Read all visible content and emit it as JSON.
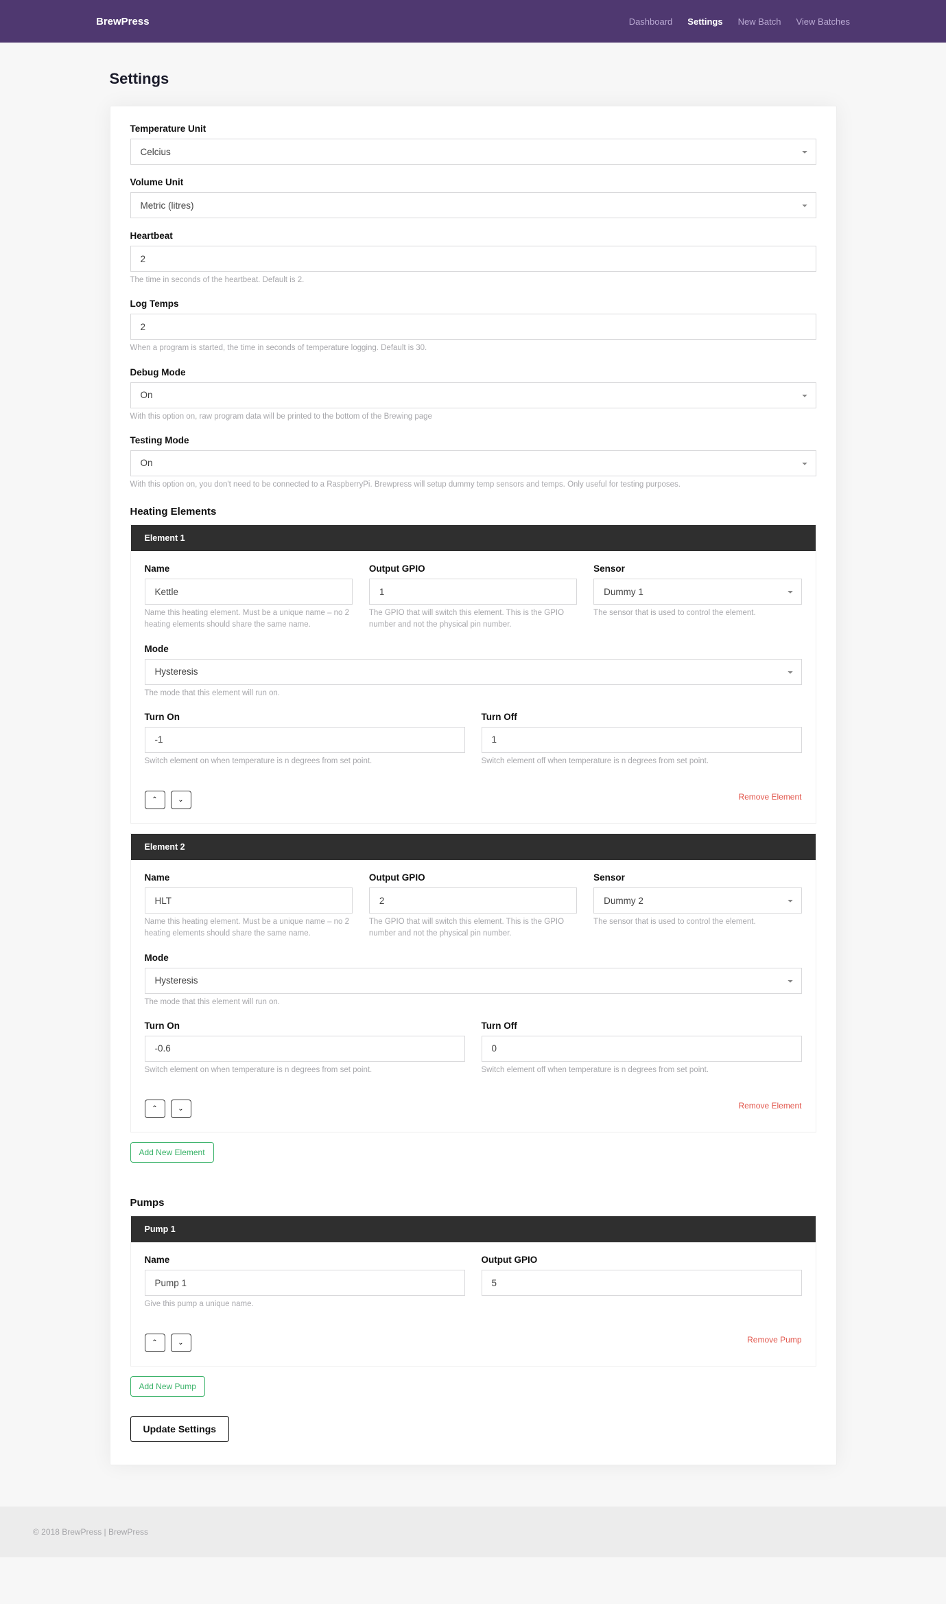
{
  "brand": "BrewPress",
  "nav": {
    "dashboard": "Dashboard",
    "settings": "Settings",
    "newBatch": "New Batch",
    "viewBatches": "View Batches"
  },
  "pageTitle": "Settings",
  "tempUnit": {
    "label": "Temperature Unit",
    "value": "Celcius"
  },
  "volUnit": {
    "label": "Volume Unit",
    "value": "Metric (litres)"
  },
  "heartbeat": {
    "label": "Heartbeat",
    "value": "2",
    "help": "The time in seconds of the heartbeat. Default is 2."
  },
  "logTemps": {
    "label": "Log Temps",
    "value": "2",
    "help": "When a program is started, the time in seconds of temperature logging. Default is 30."
  },
  "debugMode": {
    "label": "Debug Mode",
    "value": "On",
    "help": "With this option on, raw program data will be printed to the bottom of the Brewing page"
  },
  "testingMode": {
    "label": "Testing Mode",
    "value": "On",
    "help": "With this option on, you don't need to be connected to a RaspberryPi. Brewpress will setup dummy temp sensors and temps. Only useful for testing purposes."
  },
  "heating": {
    "title": "Heating Elements",
    "labels": {
      "name": "Name",
      "gpio": "Output GPIO",
      "sensor": "Sensor",
      "mode": "Mode",
      "turnOn": "Turn On",
      "turnOff": "Turn Off"
    },
    "help": {
      "name": "Name this heating element. Must be a unique name – no 2 heating elements should share the same name.",
      "gpio": "The GPIO that will switch this element. This is the GPIO number and not the physical pin number.",
      "sensor": "The sensor that is used to control the element.",
      "mode": "The mode that this element will run on.",
      "turnOn": "Switch element on when temperature is n degrees from set point.",
      "turnOff": "Switch element off when temperature is n degrees from set point."
    },
    "remove": "Remove Element",
    "add": "Add New Element",
    "items": [
      {
        "hd": "Element 1",
        "name": "Kettle",
        "gpio": "1",
        "sensor": "Dummy 1",
        "mode": "Hysteresis",
        "turnOn": "-1",
        "turnOff": "1"
      },
      {
        "hd": "Element 2",
        "name": "HLT",
        "gpio": "2",
        "sensor": "Dummy 2",
        "mode": "Hysteresis",
        "turnOn": "-0.6",
        "turnOff": "0"
      }
    ]
  },
  "pumps": {
    "title": "Pumps",
    "labels": {
      "name": "Name",
      "gpio": "Output GPIO"
    },
    "help": {
      "name": "Give this pump a unique name."
    },
    "remove": "Remove Pump",
    "add": "Add New Pump",
    "items": [
      {
        "hd": "Pump 1",
        "name": "Pump 1",
        "gpio": "5"
      }
    ]
  },
  "submit": "Update Settings",
  "footer": "© 2018 BrewPress | BrewPress"
}
